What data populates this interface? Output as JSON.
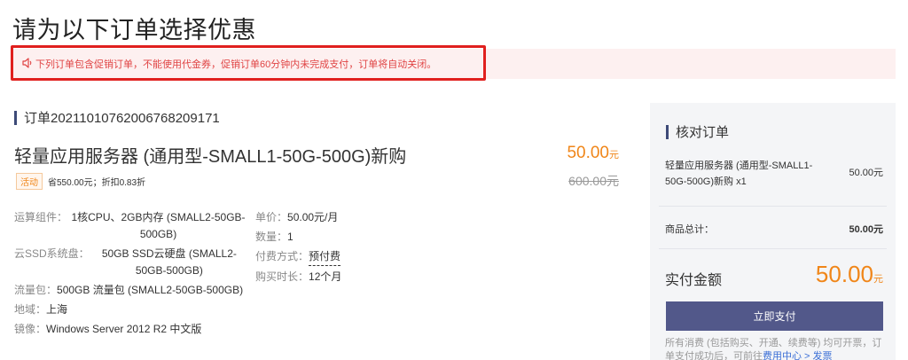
{
  "page": {
    "title": "请为以下订单选择优惠"
  },
  "notice": {
    "icon": "speaker-icon",
    "text": "下列订单包含促销订单，不能使用代金券，促销订单60分钟内未完成支付，订单将自动关闭。",
    "highlight_color": "#e0201e"
  },
  "order": {
    "id_label": "订单2021101076200676820917​1",
    "product_name": "轻量应用服务器 (通用型-SMALL1-50G-500G)新购",
    "price_now": "50.00",
    "price_unit": "元",
    "price_old": "600.00元",
    "promo_tag": "活动",
    "promo_text": "省550.00元；折扣0.83折",
    "specs_left": [
      {
        "label": "运算组件：",
        "value": "1核CPU、2GB内存 (SMALL2-50GB-500GB)"
      },
      {
        "label": "云SSD系统盘：",
        "value": "50GB SSD云硬盘 (SMALL2-50GB-500GB)"
      },
      {
        "label": "流量包：",
        "value": "500GB 流量包 (SMALL2-50GB-500GB)"
      },
      {
        "label": "地域：",
        "value": "上海"
      },
      {
        "label": "镜像：",
        "value": "Windows Server 2012 R2 中文版"
      }
    ],
    "specs_right": [
      {
        "label": "单价：",
        "value": "50.00元/月"
      },
      {
        "label": "数量：",
        "value": "1"
      },
      {
        "label": "付费方式：",
        "value": "预付费"
      },
      {
        "label": "购买时长：",
        "value": "12个月"
      }
    ]
  },
  "summary": {
    "title": "核对订单",
    "item_name": "轻量应用服务器 (通用型-SMALL1-50G-500G)新购 x1",
    "item_price": "50.00元",
    "total_label": "商品总计：",
    "total_value": "50.00元",
    "pay_label": "实付金额",
    "pay_amount": "50.00",
    "pay_unit": "元",
    "pay_button": "立即支付",
    "note_text": "所有消费 (包括购买、开通、续费等) 均可开票，订单支付成功后，可前往",
    "note_link": "费用中心 > 发票"
  },
  "colors": {
    "accent_orange": "#f08619",
    "button": "#52588a",
    "title_bar": "#3d4a78"
  }
}
